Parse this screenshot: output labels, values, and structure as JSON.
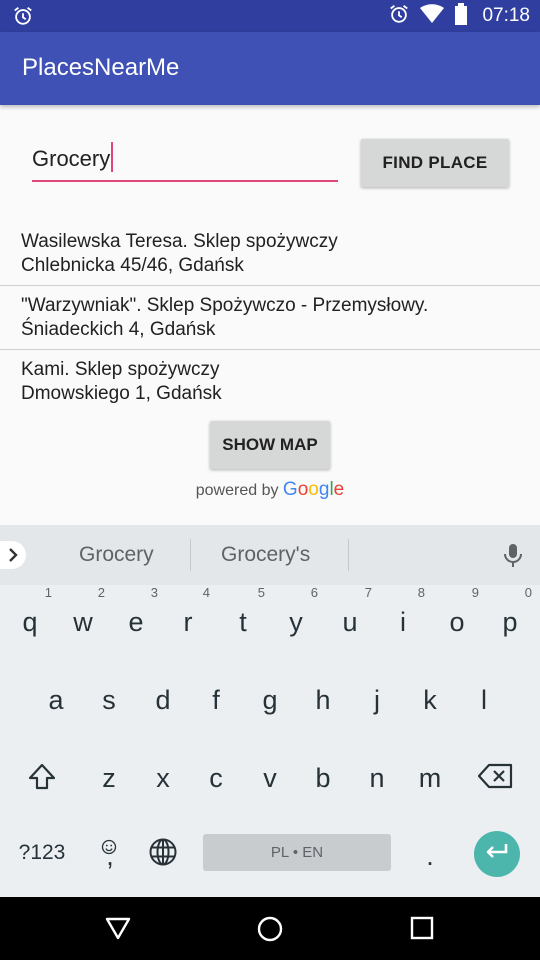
{
  "status_bar": {
    "time": "07:18",
    "left_icon": "alarm-icon",
    "right_icons": [
      "alarm-icon",
      "wifi-icon",
      "battery-icon"
    ]
  },
  "app_bar": {
    "title": "PlacesNearMe"
  },
  "search": {
    "value": "Grocery",
    "button_label": "FIND PLACE"
  },
  "results": [
    {
      "name": "Wasilewska Teresa. Sklep spożywczy",
      "address": "Chlebnicka 45/46, Gdańsk"
    },
    {
      "name": "\"Warzywniak\". Sklep Spożywczo - Przemysłowy.",
      "address": "Śniadeckich 4, Gdańsk"
    },
    {
      "name": "Kami. Sklep spożywczy",
      "address": "Dmowskiego 1, Gdańsk"
    }
  ],
  "show_map_label": "SHOW MAP",
  "attribution": {
    "prefix": "powered by",
    "brand": "Google"
  },
  "keyboard": {
    "suggestions": [
      "Grocery",
      "Grocery's"
    ],
    "row1": [
      "q",
      "w",
      "e",
      "r",
      "t",
      "y",
      "u",
      "i",
      "o",
      "p"
    ],
    "row1_hints": [
      "1",
      "2",
      "3",
      "4",
      "5",
      "6",
      "7",
      "8",
      "9",
      "0"
    ],
    "row2": [
      "a",
      "s",
      "d",
      "f",
      "g",
      "h",
      "j",
      "k",
      "l"
    ],
    "row3": [
      "z",
      "x",
      "c",
      "v",
      "b",
      "n",
      "m"
    ],
    "symbols_key": "?123",
    "comma_key": ",",
    "period_key": ".",
    "space_label": "PL • EN"
  },
  "colors": {
    "status_bar": "#303f9f",
    "app_bar": "#3f51b5",
    "accent": "#e0457b",
    "enter_key": "#4db6ac"
  }
}
